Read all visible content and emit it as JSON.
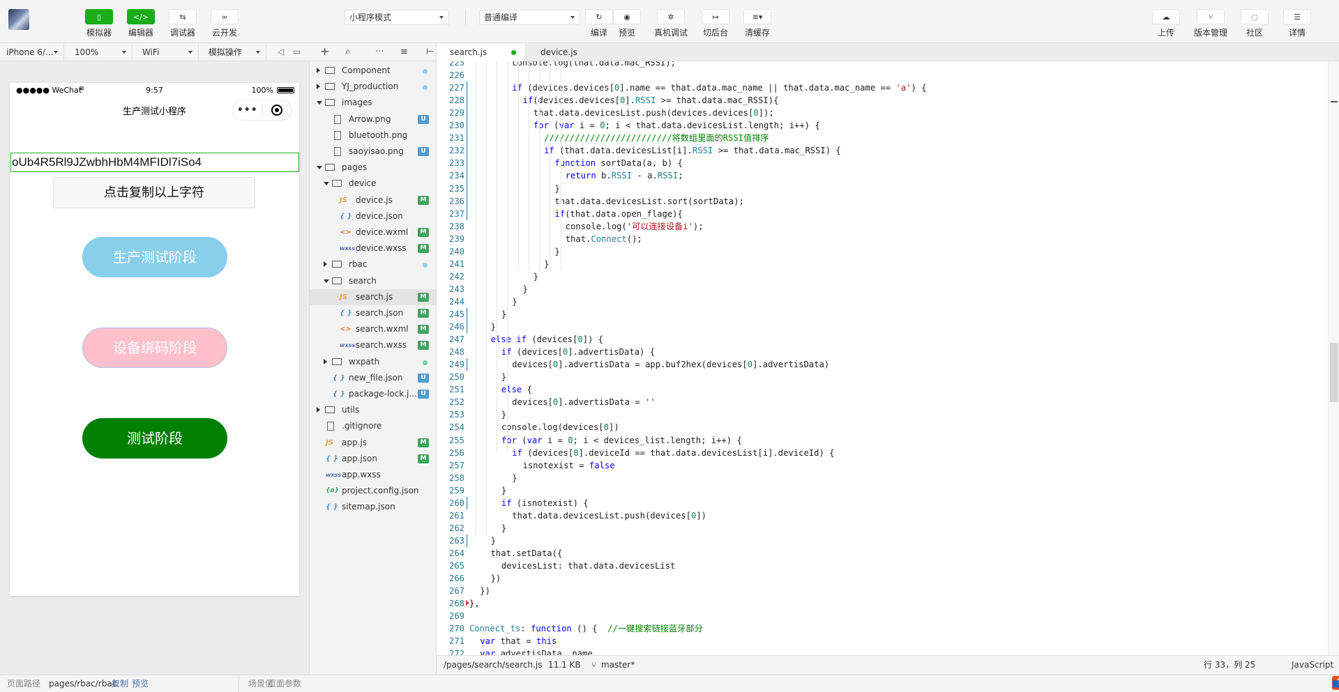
{
  "toolbar": {
    "left_buttons": [
      {
        "name": "simulator",
        "icon": "phone-icon",
        "label": "模拟器",
        "glyph": "▯",
        "active": true
      },
      {
        "name": "editor",
        "icon": "code-icon",
        "label": "编辑器",
        "glyph": "</>",
        "active": true
      },
      {
        "name": "debugger",
        "icon": "debug-arrows-icon",
        "label": "调试器",
        "glyph": "⇆",
        "active": false
      },
      {
        "name": "cloud",
        "icon": "cloud-link-icon",
        "label": "云开发",
        "glyph": "⛓",
        "active": false
      }
    ],
    "mode_select": "小程序模式",
    "compile_select": "普通编译",
    "mid_buttons": [
      {
        "name": "compile",
        "icon": "refresh-icon",
        "label": "编译",
        "glyph": "↻"
      },
      {
        "name": "preview",
        "icon": "eye-icon",
        "label": "预览",
        "glyph": "◉"
      },
      {
        "name": "remote-debug",
        "icon": "bug-icon",
        "label": "真机调试",
        "glyph": "✲"
      },
      {
        "name": "background",
        "icon": "switch-bg-icon",
        "label": "切后台",
        "glyph": "↦"
      },
      {
        "name": "clear-cache",
        "icon": "layers-icon",
        "label": "清缓存",
        "glyph": "≋▾"
      }
    ],
    "right_buttons": [
      {
        "name": "upload",
        "icon": "cloud-upload-icon",
        "label": "上传",
        "glyph": "☁"
      },
      {
        "name": "version",
        "icon": "branch-icon",
        "label": "版本管理",
        "glyph": "⑂"
      },
      {
        "name": "community",
        "icon": "chat-icon",
        "label": "社区",
        "glyph": "💬"
      },
      {
        "name": "details",
        "icon": "menu-icon",
        "label": "详情",
        "glyph": "☰"
      }
    ]
  },
  "sim_bar": {
    "device": "iPhone 6/...",
    "zoom": "100%",
    "network": "WiFi",
    "operation": "模拟操作"
  },
  "phone": {
    "status_carrier": "●●●●● WeChat",
    "status_time": "9:57",
    "status_battery": "100%",
    "nav_title": "生产测试小程序",
    "openid": "oUb4R5Rl9JZwbhHbM4MFIDl7iSo4",
    "copy_button": "点击复制以上字符",
    "stage_buttons": [
      "生产测试阶段",
      "设备绑码阶段",
      "测试阶段"
    ],
    "colors": {
      "stage1": "#87ceeb",
      "stage2": "#ffc0cb",
      "stage3": "#008000"
    }
  },
  "tree": {
    "items": [
      {
        "depth": 0,
        "type": "folder",
        "expanded": false,
        "name": "Component",
        "status": "dot-blue"
      },
      {
        "depth": 0,
        "type": "folder",
        "expanded": false,
        "name": "YJ_production",
        "status": "dot-blue"
      },
      {
        "depth": 0,
        "type": "folder",
        "expanded": true,
        "name": "images",
        "status": ""
      },
      {
        "depth": 1,
        "type": "file",
        "ext": "png",
        "name": "Arrow.png",
        "status": "U"
      },
      {
        "depth": 1,
        "type": "file",
        "ext": "png",
        "name": "bluetooth.png",
        "status": ""
      },
      {
        "depth": 1,
        "type": "file",
        "ext": "png",
        "name": "saoyisao.png",
        "status": "U"
      },
      {
        "depth": 0,
        "type": "folder",
        "expanded": true,
        "name": "pages",
        "status": ""
      },
      {
        "depth": 1,
        "type": "folder",
        "expanded": true,
        "name": "device",
        "status": ""
      },
      {
        "depth": 2,
        "type": "file",
        "ext": "js",
        "name": "device.js",
        "status": "M"
      },
      {
        "depth": 2,
        "type": "file",
        "ext": "json",
        "name": "device.json",
        "status": ""
      },
      {
        "depth": 2,
        "type": "file",
        "ext": "wxml",
        "name": "device.wxml",
        "status": "M"
      },
      {
        "depth": 2,
        "type": "file",
        "ext": "wxss",
        "name": "device.wxss",
        "status": "M"
      },
      {
        "depth": 1,
        "type": "folder",
        "expanded": false,
        "name": "rbac",
        "status": "dot-blue"
      },
      {
        "depth": 1,
        "type": "folder",
        "expanded": true,
        "name": "search",
        "status": ""
      },
      {
        "depth": 2,
        "type": "file",
        "ext": "js",
        "name": "search.js",
        "status": "M",
        "selected": true
      },
      {
        "depth": 2,
        "type": "file",
        "ext": "json",
        "name": "search.json",
        "status": "M"
      },
      {
        "depth": 2,
        "type": "file",
        "ext": "wxml",
        "name": "search.wxml",
        "status": "M"
      },
      {
        "depth": 2,
        "type": "file",
        "ext": "wxss",
        "name": "search.wxss",
        "status": "M"
      },
      {
        "depth": 1,
        "type": "folder",
        "expanded": false,
        "name": "wxpath",
        "status": "dot-green"
      },
      {
        "depth": 1,
        "type": "file",
        "ext": "json",
        "name": "new_file.json",
        "status": "U"
      },
      {
        "depth": 1,
        "type": "file",
        "ext": "json",
        "name": "package-lock.j...",
        "status": "U"
      },
      {
        "depth": 0,
        "type": "folder",
        "expanded": false,
        "name": "utils",
        "status": ""
      },
      {
        "depth": 0,
        "type": "file",
        "ext": "plain",
        "name": ".gitignore",
        "status": ""
      },
      {
        "depth": 0,
        "type": "file",
        "ext": "js",
        "name": "app.js",
        "status": "M"
      },
      {
        "depth": 0,
        "type": "file",
        "ext": "json",
        "name": "app.json",
        "status": "M"
      },
      {
        "depth": 0,
        "type": "file",
        "ext": "wxss",
        "name": "app.wxss",
        "status": ""
      },
      {
        "depth": 0,
        "type": "file",
        "ext": "conf",
        "name": "project.config.json",
        "status": ""
      },
      {
        "depth": 0,
        "type": "file",
        "ext": "json",
        "name": "sitemap.json",
        "status": ""
      }
    ]
  },
  "editor": {
    "tabs": [
      {
        "label": "search.js",
        "active": true,
        "modified": true
      },
      {
        "label": "device.js",
        "active": false,
        "modified": false
      }
    ],
    "lines": [
      {
        "n": "225",
        "i": 4,
        "c": "console.log(that.data.mac_RSSI);"
      },
      {
        "n": "226",
        "i": 0,
        "c": ""
      },
      {
        "n": "227",
        "i": 4,
        "c": "if (devices.devices[0].name == that.data.mac_name || that.data.mac_name == 'a') {"
      },
      {
        "n": "228",
        "i": 5,
        "c": "if(devices.devices[0].RSSI >= that.data.mac_RSSI){"
      },
      {
        "n": "229",
        "i": 6,
        "c": "that.data.devicesList.push(devices.devices[0]);"
      },
      {
        "n": "230",
        "i": 6,
        "c": "for (var i = 0; i < that.data.devicesList.length; i++) {"
      },
      {
        "n": "231",
        "i": 7,
        "c": "/////////////////////////将数组里面的RSSI值排序"
      },
      {
        "n": "232",
        "i": 7,
        "c": "if (that.data.devicesList[i].RSSI >= that.data.mac_RSSI) {"
      },
      {
        "n": "233",
        "i": 8,
        "c": "function sortData(a, b) {"
      },
      {
        "n": "234",
        "i": 9,
        "c": "return b.RSSI - a.RSSI;"
      },
      {
        "n": "235",
        "i": 8,
        "c": "}"
      },
      {
        "n": "236",
        "i": 8,
        "c": "that.data.devicesList.sort(sortData);"
      },
      {
        "n": "237",
        "i": 8,
        "c": "if(that.data.open_flage){"
      },
      {
        "n": "238",
        "i": 9,
        "c": "console.log('可以连接设备i');"
      },
      {
        "n": "239",
        "i": 9,
        "c": "that.Connect();"
      },
      {
        "n": "240",
        "i": 8,
        "c": "}"
      },
      {
        "n": "241",
        "i": 7,
        "c": "}"
      },
      {
        "n": "242",
        "i": 6,
        "c": "}"
      },
      {
        "n": "243",
        "i": 5,
        "c": "}"
      },
      {
        "n": "244",
        "i": 4,
        "c": "}"
      },
      {
        "n": "245",
        "i": 3,
        "c": "}"
      },
      {
        "n": "246",
        "i": 2,
        "c": "}"
      },
      {
        "n": "247",
        "i": 2,
        "c": "else if (devices[0]) {"
      },
      {
        "n": "248",
        "i": 3,
        "c": "if (devices[0].advertisData) {"
      },
      {
        "n": "249",
        "i": 4,
        "c": "devices[0].advertisData = app.buf2hex(devices[0].advertisData)"
      },
      {
        "n": "250",
        "i": 3,
        "c": "}"
      },
      {
        "n": "251",
        "i": 3,
        "c": "else {"
      },
      {
        "n": "252",
        "i": 4,
        "c": "devices[0].advertisData = ''"
      },
      {
        "n": "253",
        "i": 3,
        "c": "}"
      },
      {
        "n": "254",
        "i": 3,
        "c": "console.log(devices[0])"
      },
      {
        "n": "255",
        "i": 3,
        "c": "for (var i = 0; i < devices_list.length; i++) {"
      },
      {
        "n": "256",
        "i": 4,
        "c": "if (devices[0].deviceId == that.data.devicesList[i].deviceId) {"
      },
      {
        "n": "257",
        "i": 5,
        "c": "isnotexist = false"
      },
      {
        "n": "258",
        "i": 4,
        "c": "}"
      },
      {
        "n": "259",
        "i": 3,
        "c": "}"
      },
      {
        "n": "260",
        "i": 3,
        "c": "if (isnotexist) {"
      },
      {
        "n": "261",
        "i": 4,
        "c": "that.data.devicesList.push(devices[0])"
      },
      {
        "n": "262",
        "i": 3,
        "c": "}"
      },
      {
        "n": "263",
        "i": 2,
        "c": "}"
      },
      {
        "n": "264",
        "i": 2,
        "c": "that.setData({"
      },
      {
        "n": "265",
        "i": 3,
        "c": "devicesList: that.data.devicesList"
      },
      {
        "n": "266",
        "i": 2,
        "c": "})"
      },
      {
        "n": "267",
        "i": 1,
        "c": "})"
      },
      {
        "n": "268",
        "i": 0,
        "c": "},"
      },
      {
        "n": "269",
        "i": 0,
        "c": ""
      },
      {
        "n": "270",
        "i": 0,
        "c": "Connect_ts: function () {  //一键搜索链接蓝牙部分"
      },
      {
        "n": "271",
        "i": 1,
        "c": "var that = this"
      },
      {
        "n": "272",
        "i": 1,
        "c": "var advertisData, name"
      }
    ],
    "status": {
      "path": "/pages/search/search.js",
      "size": "11.1 KB",
      "branch": "master*",
      "position": "行 33，列 25",
      "language": "JavaScript"
    }
  },
  "bottom": {
    "path_label": "页面路径",
    "path_value": "pages/rbac/rbac",
    "copy": "复制",
    "preview": "预览",
    "scene": "场景值",
    "params": "页面参数",
    "ime": "英"
  }
}
